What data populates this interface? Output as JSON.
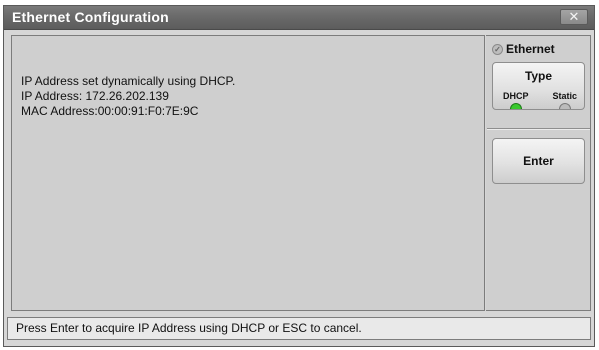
{
  "window": {
    "title": "Ethernet Configuration",
    "close_symbol": "✕"
  },
  "main": {
    "line1": "IP Address set dynamically using DHCP.",
    "line2": "IP Address: 172.26.202.139",
    "line3": "MAC Address:00:00:91:F0:7E:9C"
  },
  "sidebar": {
    "ethernet_label": "Ethernet",
    "ethernet_icon_symbol": "✓",
    "type_button": {
      "label": "Type",
      "option_dhcp": "DHCP",
      "option_static": "Static",
      "selected": "DHCP"
    },
    "enter_button_label": "Enter"
  },
  "status_bar": {
    "text": "Press Enter to acquire IP Address using DHCP or ESC to cancel."
  },
  "colors": {
    "title_bar": "#6a6a6a",
    "panel_bg": "#cfcfcf",
    "led_active": "#39c92e",
    "led_inactive": "#bcbcbc"
  }
}
